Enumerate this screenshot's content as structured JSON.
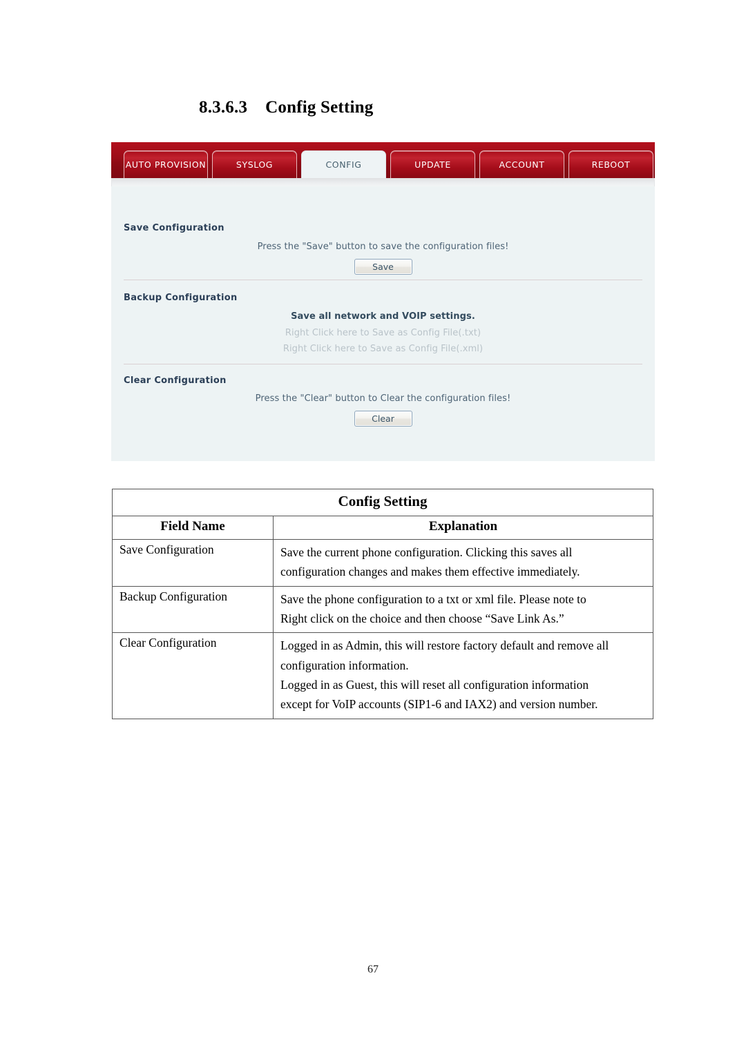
{
  "document": {
    "section_number": "8.3.6.3",
    "section_title": "Config Setting",
    "page_number": "67"
  },
  "webui": {
    "tabs": [
      {
        "label": "AUTO PROVISION",
        "active": false
      },
      {
        "label": "SYSLOG",
        "active": false
      },
      {
        "label": "CONFIG",
        "active": true
      },
      {
        "label": "UPDATE",
        "active": false
      },
      {
        "label": "ACCOUNT",
        "active": false
      },
      {
        "label": "REBOOT",
        "active": false
      }
    ],
    "sections": {
      "save": {
        "label": "Save Configuration",
        "description": "Press the \"Save\" button to save the configuration files!",
        "button": "Save"
      },
      "backup": {
        "label": "Backup Configuration",
        "description": "Save all network and VOIP settings.",
        "link_txt": "Right Click here to Save as Config File(.txt)",
        "link_xml": "Right Click here to Save as Config File(.xml)"
      },
      "clear": {
        "label": "Clear Configuration",
        "description": "Press the \"Clear\" button to Clear the configuration files!",
        "button": "Clear"
      }
    },
    "colors": {
      "tabbar_red": "#9d0c18",
      "active_tab_bg": "#eef3f5",
      "panel_bg": "#edf3f4",
      "label_text": "#2b3f57"
    }
  },
  "table": {
    "title": "Config Setting",
    "headers": [
      "Field Name",
      "Explanation"
    ],
    "rows": [
      {
        "field": "Save Configuration",
        "lines": [
          "Save the current phone configuration. Clicking this saves all",
          "configuration changes and makes them effective immediately."
        ]
      },
      {
        "field": "Backup Configuration",
        "lines": [
          "Save the phone configuration to a txt or xml file.    Please note to",
          "Right click on the choice and then choose “Save Link As.”"
        ]
      },
      {
        "field": "Clear Configuration",
        "lines": [
          "Logged in as Admin, this will restore factory default and remove all",
          "configuration information.",
          "Logged in as Guest, this will reset all configuration information",
          "except for VoIP accounts (SIP1-6 and IAX2) and version number."
        ]
      }
    ]
  }
}
